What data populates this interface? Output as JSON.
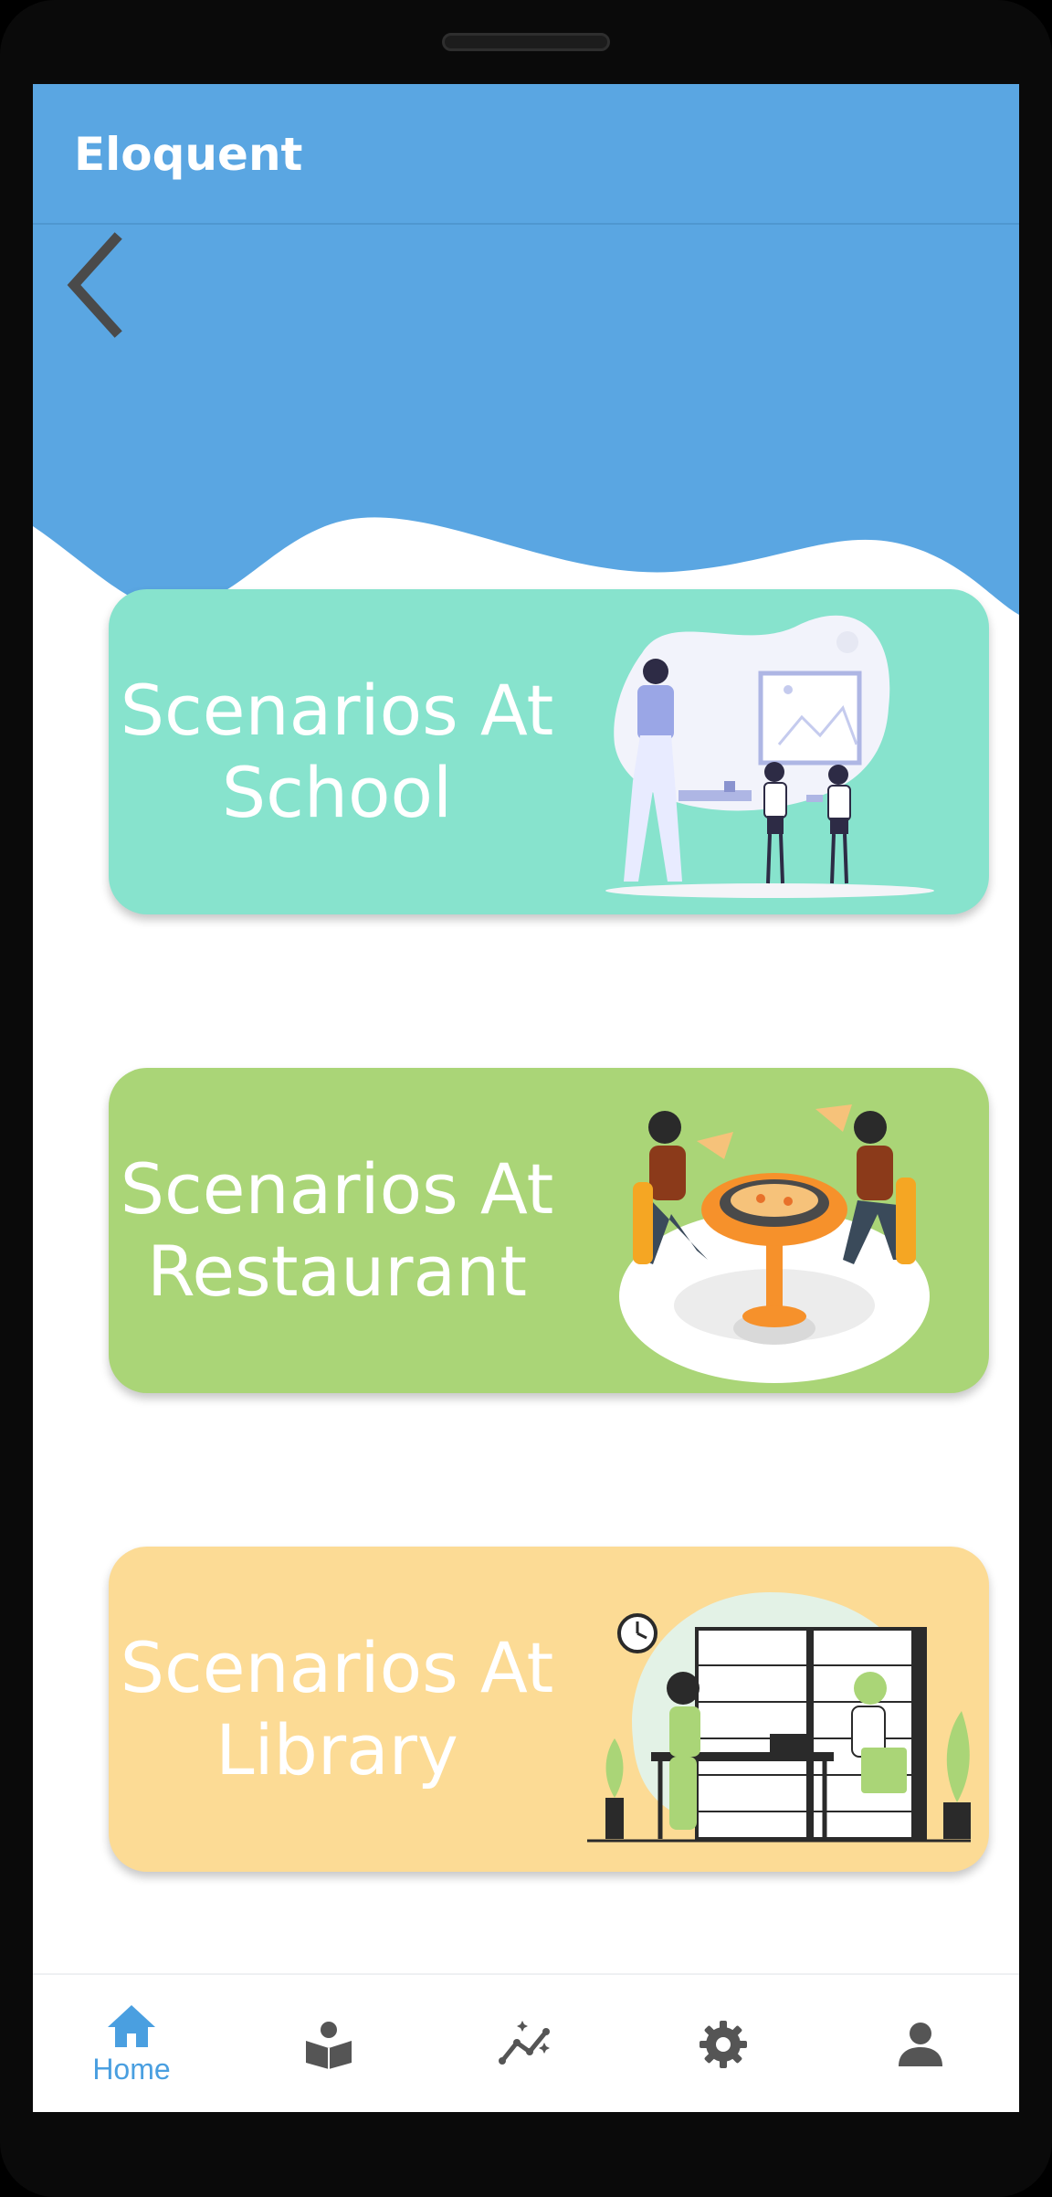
{
  "app": {
    "title": "Eloquent"
  },
  "colors": {
    "header": "#5aa6e2",
    "accent": "#4a9fe0",
    "school": "#87e3cd",
    "restaurant": "#aad577",
    "library": "#fcdb95",
    "icon_inactive": "#555555"
  },
  "header": {
    "back_icon": "chevron-left-icon"
  },
  "cards": [
    {
      "line1": "Scenarios At",
      "line2": "School",
      "color": "#87e3cd",
      "art": "classroom-illustration"
    },
    {
      "line1": "Scenarios At",
      "line2": "Restaurant",
      "color": "#aad577",
      "art": "dining-illustration"
    },
    {
      "line1": "Scenarios At",
      "line2": "Library",
      "color": "#fcdb95",
      "art": "library-illustration"
    }
  ],
  "bottom_nav": {
    "items": [
      {
        "label": "Home",
        "icon": "home-icon",
        "active": true
      },
      {
        "label": "",
        "icon": "book-reader-icon",
        "active": false
      },
      {
        "label": "",
        "icon": "progress-chart-icon",
        "active": false
      },
      {
        "label": "",
        "icon": "gear-icon",
        "active": false
      },
      {
        "label": "",
        "icon": "person-icon",
        "active": false
      }
    ]
  }
}
